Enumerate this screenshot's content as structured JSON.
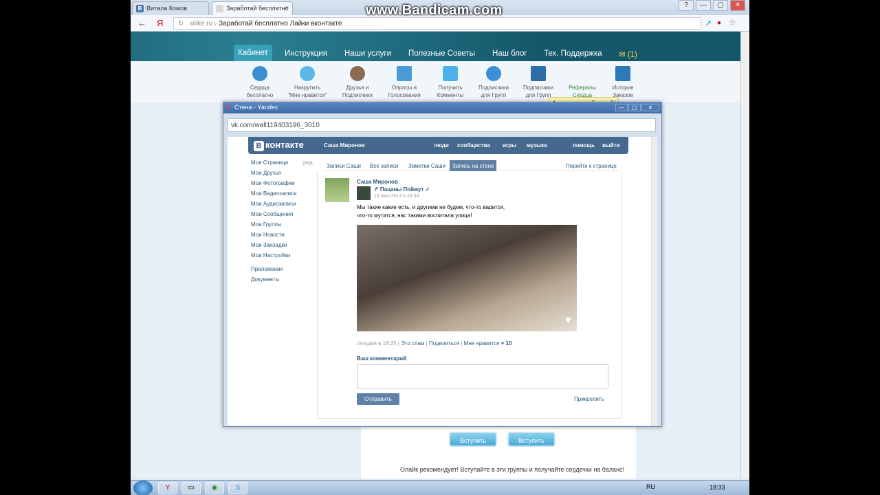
{
  "watermark": "www.Bandicam.com",
  "browser": {
    "tabs": [
      {
        "label": "Витала Комов",
        "favicon": "В"
      },
      {
        "label": "Заработай бесплатно",
        "close": "×"
      }
    ],
    "window_controls": [
      "?",
      "—",
      "▢",
      "✕"
    ],
    "nav": {
      "back": "←",
      "ya": "Я"
    },
    "url_domain": "olike.ru",
    "url_sep": " › ",
    "url_title": "Заработай бесплатно Лайки вконтакте"
  },
  "site": {
    "nav": [
      "Кабинет",
      "Инструкция",
      "Наши услуги",
      "Полезные Советы",
      "Наш блог",
      "Тех. Поддержка"
    ],
    "mail": "✉ (1)",
    "tooltip": "1 важных сообщений!",
    "subnav": [
      {
        "line1": "Сердца",
        "line2": "бесплатно"
      },
      {
        "line1": "Накрутить",
        "line2": "\"Мне нравится\""
      },
      {
        "line1": "Друзья и",
        "line2": "Подписчики"
      },
      {
        "line1": "Опросы и",
        "line2": "Голосования"
      },
      {
        "line1": "Получить",
        "line2": "Комменты"
      },
      {
        "line1": "Подписчики",
        "line2": "для Групп"
      },
      {
        "line1": "Подписчики",
        "line2": "для Групп"
      },
      {
        "line1": "Рефералы",
        "line2": "Сердца"
      },
      {
        "line1": "История",
        "line2": "Заказов"
      }
    ],
    "join_buttons": [
      "Вступить",
      "Вступить"
    ],
    "recommend": "Олайк рекомендует! Вступайте в эти группы и получайте сердечки на баланс!"
  },
  "popup": {
    "title": "Стена - Yandex",
    "address": "vk.com/wall119403196_3010"
  },
  "vk": {
    "logo": "контакте",
    "user": "Саша Миронов",
    "menu": [
      "люди",
      "сообщества",
      "игры",
      "музыка",
      "помощь",
      "выйти"
    ],
    "side_edit": "ред.",
    "side": [
      "Моя Страница",
      "Мои Друзья",
      "Мои Фотографии",
      "Мои Видеозаписи",
      "Мои Аудиозаписи",
      "Мои Сообщения",
      "Мои Группы",
      "Мои Новости",
      "Мои Закладки",
      "Мои Настройки",
      "Приложения",
      "Документы"
    ],
    "tabs": [
      "Записи Саши",
      "Все записи",
      "Заметки Саши",
      "Запись на стене"
    ],
    "goto": "Перейти к странице",
    "post": {
      "author": "Саша Миронов",
      "group": "↱ Пацаны Поймут ✓",
      "date": "23 июл 2013 в 23:34",
      "text1": "Мы такие какие есть, и другими не будем, что-то варится,",
      "text2": "что-то мутится, нас такими воспитала улица!",
      "meta_time": "сегодня в 18:25",
      "meta_spam": "Это спам",
      "meta_share": "Поделиться",
      "meta_like": "Мне нравится",
      "likes": "10",
      "comment_label": "Ваш комментарий",
      "send": "Отправить",
      "attach": "Прикрепить"
    }
  },
  "taskbar": {
    "lang": "RU",
    "clock": "18:33"
  }
}
